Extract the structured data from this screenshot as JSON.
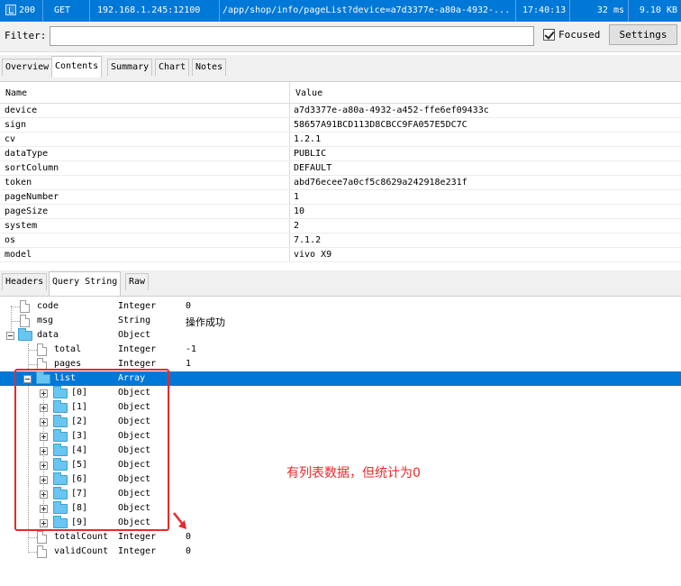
{
  "session": {
    "status": "200",
    "method": "GET",
    "host": "192.168.1.245:12100",
    "url": "/app/shop/info/pageList?device=a7d3377e-a80a-4932-...",
    "time": "17:40:13",
    "duration": "32 ms",
    "size": "9.10 KB"
  },
  "filter": {
    "label": "Filter:",
    "value": "",
    "focused_label": "Focused",
    "settings_label": "Settings"
  },
  "inspector_tabs": [
    "Overview",
    "Contents",
    "Summary",
    "Chart",
    "Notes"
  ],
  "kv": {
    "headers": [
      "Name",
      "Value"
    ],
    "rows": [
      {
        "name": "device",
        "value": "a7d3377e-a80a-4932-a452-ffe6ef09433c"
      },
      {
        "name": "sign",
        "value": "58657A91BCD113D8CBCC9FA057E5DC7C"
      },
      {
        "name": "cv",
        "value": "1.2.1"
      },
      {
        "name": "dataType",
        "value": "PUBLIC"
      },
      {
        "name": "sortColumn",
        "value": "DEFAULT"
      },
      {
        "name": "token",
        "value": "abd76ecee7a0cf5c8629a242918e231f"
      },
      {
        "name": "pageNumber",
        "value": "1"
      },
      {
        "name": "pageSize",
        "value": "10"
      },
      {
        "name": "system",
        "value": "2"
      },
      {
        "name": "os",
        "value": "7.1.2"
      },
      {
        "name": "model",
        "value": "vivo X9"
      }
    ]
  },
  "response_tabs": [
    "Headers",
    "Query String",
    "Raw"
  ],
  "tree": {
    "nodes": [
      {
        "name": "code",
        "type": "Integer",
        "value": "0"
      },
      {
        "name": "msg",
        "type": "String",
        "value": "操作成功"
      },
      {
        "name": "data",
        "type": "Object",
        "value": ""
      },
      {
        "name": "total",
        "type": "Integer",
        "value": "-1"
      },
      {
        "name": "pages",
        "type": "Integer",
        "value": "1"
      },
      {
        "name": "list",
        "type": "Array",
        "value": ""
      },
      {
        "name": "[0]",
        "type": "Object",
        "value": ""
      },
      {
        "name": "[1]",
        "type": "Object",
        "value": ""
      },
      {
        "name": "[2]",
        "type": "Object",
        "value": ""
      },
      {
        "name": "[3]",
        "type": "Object",
        "value": ""
      },
      {
        "name": "[4]",
        "type": "Object",
        "value": ""
      },
      {
        "name": "[5]",
        "type": "Object",
        "value": ""
      },
      {
        "name": "[6]",
        "type": "Object",
        "value": ""
      },
      {
        "name": "[7]",
        "type": "Object",
        "value": ""
      },
      {
        "name": "[8]",
        "type": "Object",
        "value": ""
      },
      {
        "name": "[9]",
        "type": "Object",
        "value": ""
      },
      {
        "name": "totalCount",
        "type": "Integer",
        "value": "0"
      },
      {
        "name": "validCount",
        "type": "Integer",
        "value": "0"
      }
    ]
  },
  "annotation": {
    "text": "有列表数据，但统计为0",
    "color": "#e8292b"
  },
  "colors": {
    "selection": "#0078d7",
    "folder": "#69c6f0"
  }
}
